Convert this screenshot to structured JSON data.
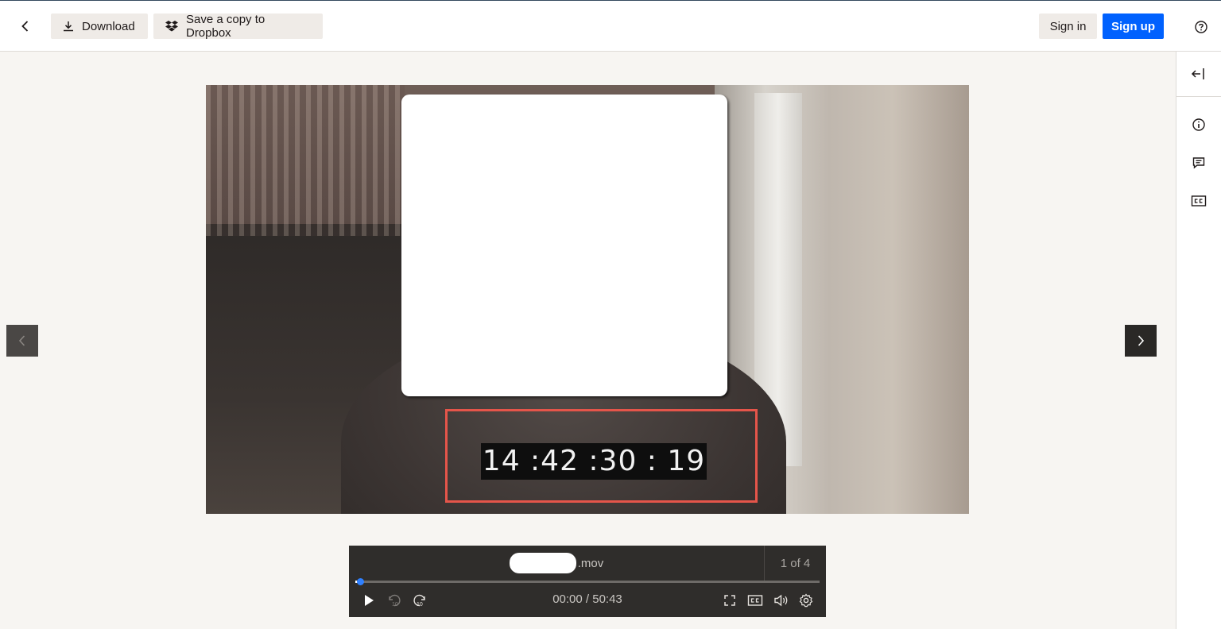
{
  "header": {
    "download_label": "Download",
    "dropbox_label": "Save a copy to Dropbox",
    "signin_label": "Sign in",
    "signup_label": "Sign up"
  },
  "colors": {
    "accent": "#0061fe",
    "highlight": "#e5554a"
  },
  "video": {
    "timecode": "14 :42 :30 : 19"
  },
  "player": {
    "filename_ext": ".mov",
    "counter": "1 of 4",
    "time": "00:00 / 50:43",
    "progress": 0.01
  },
  "icons": [
    "back-arrow-icon",
    "download-icon",
    "dropbox-icon",
    "help-icon",
    "collapse-panel-icon",
    "info-icon",
    "comment-icon",
    "captions-icon",
    "play-icon",
    "rewind-10-icon",
    "forward-10-icon",
    "fullscreen-icon",
    "volume-icon",
    "settings-icon",
    "chevron-left-icon",
    "chevron-right-icon"
  ]
}
